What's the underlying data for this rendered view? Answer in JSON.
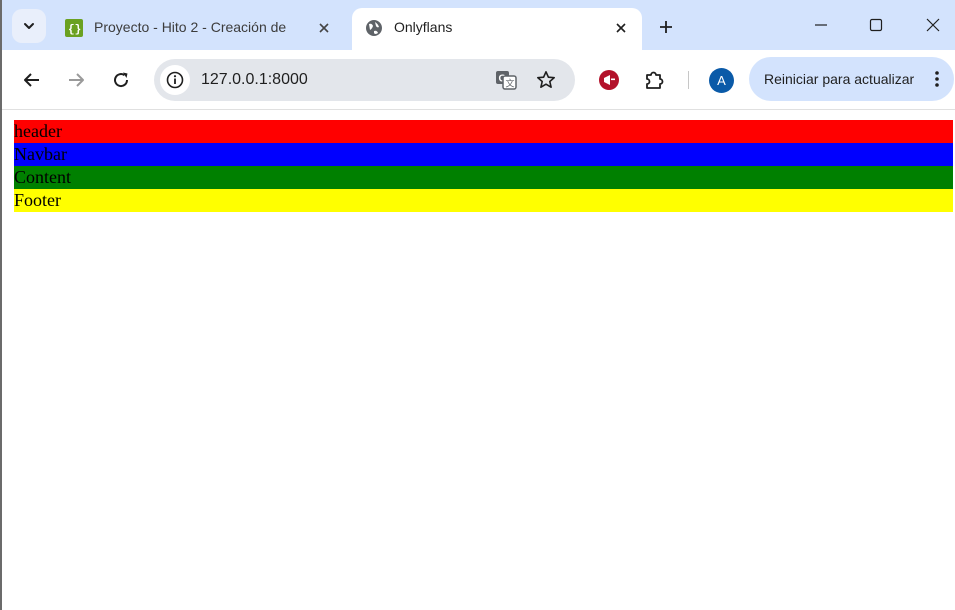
{
  "browser": {
    "tabs": [
      {
        "title": "Proyecto - Hito 2 - Creación de",
        "active": false,
        "favicon": "project-favicon-icon"
      },
      {
        "title": "Onlyflans",
        "active": true,
        "favicon": "globe-icon"
      }
    ],
    "address": "127.0.0.1:8000",
    "profile_initial": "A",
    "update_label": "Reiniciar para actualizar"
  },
  "page": {
    "sections": [
      {
        "label": "header",
        "color": "#ff0000"
      },
      {
        "label": "Navbar",
        "color": "#0000ff"
      },
      {
        "label": "Content",
        "color": "#008000"
      },
      {
        "label": "Footer",
        "color": "#ffff00"
      }
    ]
  }
}
